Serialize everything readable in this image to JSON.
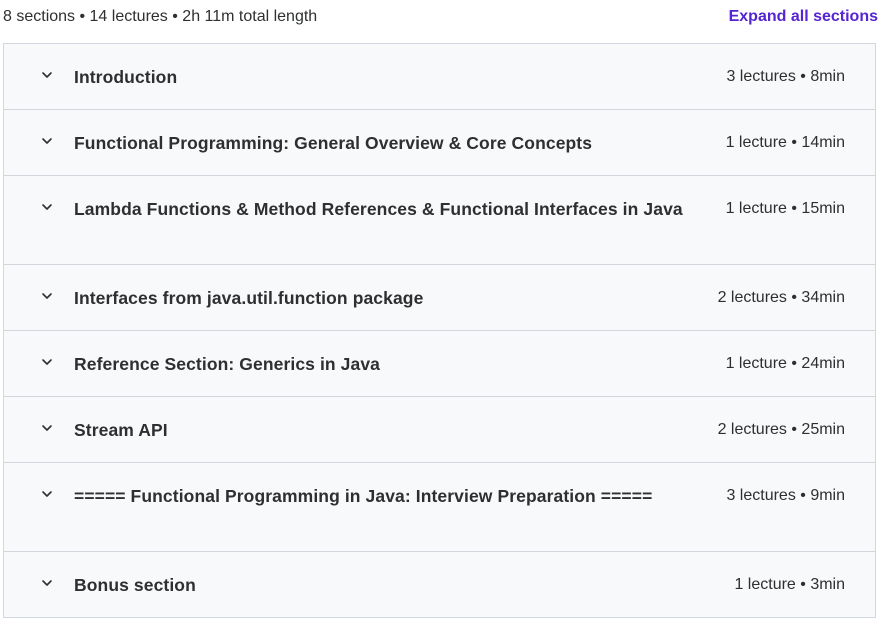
{
  "summary": {
    "text": "8 sections • 14 lectures • 2h 11m total length",
    "expand_label": "Expand all sections"
  },
  "sections": [
    {
      "title": "Introduction",
      "meta": "3 lectures • 8min"
    },
    {
      "title": "Functional Programming: General Overview & Core Concepts",
      "meta": "1 lecture • 14min"
    },
    {
      "title": "Lambda Functions & Method References & Functional Interfaces in Java",
      "meta": "1 lecture • 15min"
    },
    {
      "title": "Interfaces from java.util.function package",
      "meta": "2 lectures • 34min"
    },
    {
      "title": "Reference Section: Generics in Java",
      "meta": "1 lecture • 24min"
    },
    {
      "title": "Stream API",
      "meta": "2 lectures • 25min"
    },
    {
      "title": "===== Functional Programming in Java: Interview Preparation =====",
      "meta": "3 lectures • 9min"
    },
    {
      "title": "Bonus section",
      "meta": "1 lecture • 3min"
    }
  ],
  "icons": {
    "chevron": "chevron-down-icon"
  },
  "colors": {
    "accent": "#5624d0",
    "section_bg": "#f7f9fa",
    "border": "#d1d7dc",
    "text": "#2d2f31"
  }
}
